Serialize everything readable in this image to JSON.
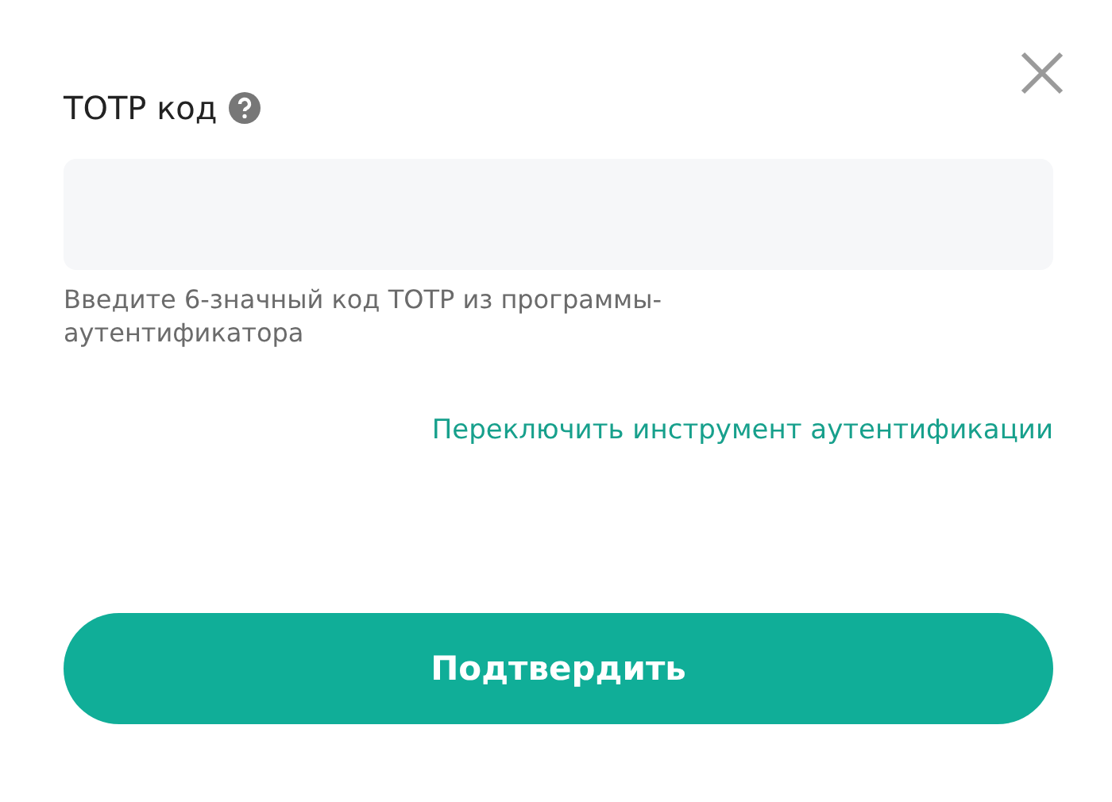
{
  "field": {
    "label": "TOTP код",
    "hint": "Введите 6-значный код TOTP из программы-аутентификатора"
  },
  "switch_link": "Переключить инструмент аутентификации",
  "confirm_button": "Подтвердить"
}
